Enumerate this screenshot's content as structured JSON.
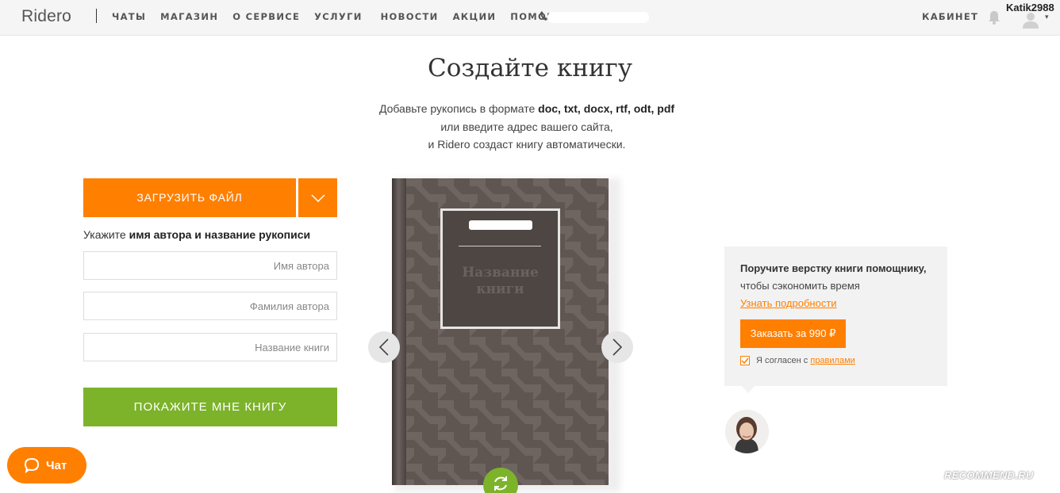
{
  "header": {
    "logo": "Ridero",
    "nav": [
      "ЧАТЫ",
      "МАГАЗИН",
      "О СЕРВИСЕ",
      "УСЛУГИ",
      "НОВОСТИ",
      "АКЦИИ",
      "ПОМОЩЬ"
    ],
    "cabinet": "КАБИНЕТ",
    "username": "Katik2988",
    "icons": [
      "phone-icon",
      "bell-icon",
      "user-avatar-icon",
      "caret-down-icon"
    ]
  },
  "main": {
    "title": "Создайте книгу",
    "subtitle_line1_prefix": "Добавьте рукопись в формате ",
    "subtitle_formats": "doc, txt, docx, rtf, odt, pdf",
    "subtitle_line2": "или введите адрес вашего сайта,",
    "subtitle_line3": "и Ridero создаст книгу автоматически."
  },
  "form": {
    "upload_label": "ЗАГРУЗИТЬ ФАЙЛ",
    "hint_prefix": "Укажите ",
    "hint_bold": "имя автора и название рукописи",
    "first_name_placeholder": "Имя автора",
    "first_name_value": "",
    "last_name_placeholder": "Фамилия автора",
    "last_name_value": "",
    "book_title_placeholder": "Название книги",
    "book_title_value": "",
    "show_label": "ПОКАЖИТЕ МНЕ КНИГУ"
  },
  "book": {
    "cover_title": "Название книги"
  },
  "promo": {
    "title": "Поручите верстку книги помощнику,",
    "text": "чтобы сэкономить время",
    "link": "Узнать подробности",
    "order_label": "Заказать за 990 ₽",
    "agree_text": "Я согласен с ",
    "agree_link": "правилами",
    "agree_checked": true
  },
  "chat": {
    "label": "Чат"
  },
  "watermark": "RECOMMEND.RU",
  "colors": {
    "accent": "#ff7f00",
    "green": "#7cb32a",
    "book_cover": "#5f5652"
  }
}
